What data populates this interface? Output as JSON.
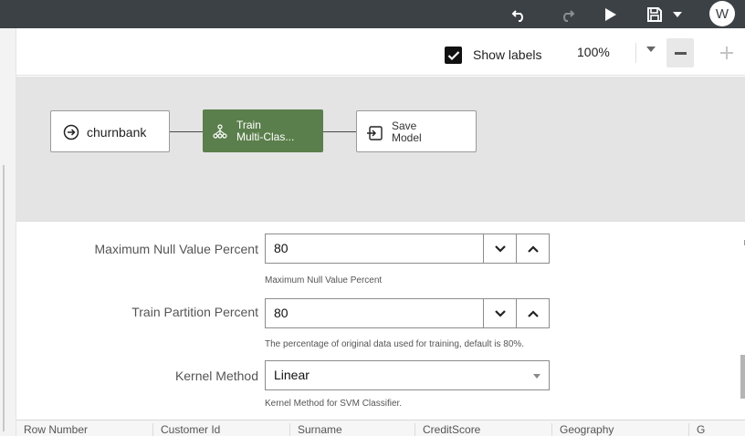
{
  "topbar": {
    "icons": [
      "undo-icon",
      "redo-icon",
      "run-icon",
      "save-icon",
      "chevron-down-icon"
    ],
    "user_initial": "W",
    "bg_color": "#3c4146"
  },
  "toolbar": {
    "show_labels": {
      "label": "Show labels",
      "checked": true
    },
    "zoom": "100%",
    "minus_icon": "minus-icon",
    "plus_icon": "plus-icon"
  },
  "workflow": {
    "nodes": [
      {
        "label": "churnbank",
        "icon": "circle-arrow-icon"
      },
      {
        "label_line1": "Train",
        "label_line2": "Multi-Clas...",
        "icon": "model-tree-icon",
        "selected": true,
        "color": "#5b7f4c"
      },
      {
        "label_line1": "Save",
        "label_line2": "Model",
        "icon": "save-model-icon"
      }
    ]
  },
  "properties": {
    "fields": [
      {
        "label": "Maximum Null Value Percent",
        "value": "80",
        "help": "Maximum Null Value Percent"
      },
      {
        "label": "Train Partition Percent",
        "value": "80",
        "help": "The percentage of original data used for training, default is 80%."
      },
      {
        "label": "Kernel Method",
        "value": "Linear",
        "help": "Kernel Method for SVM Classifier."
      }
    ]
  },
  "columns": [
    "Row Number",
    "Customer Id",
    "Surname",
    "CreditScore",
    "Geography",
    "G"
  ]
}
